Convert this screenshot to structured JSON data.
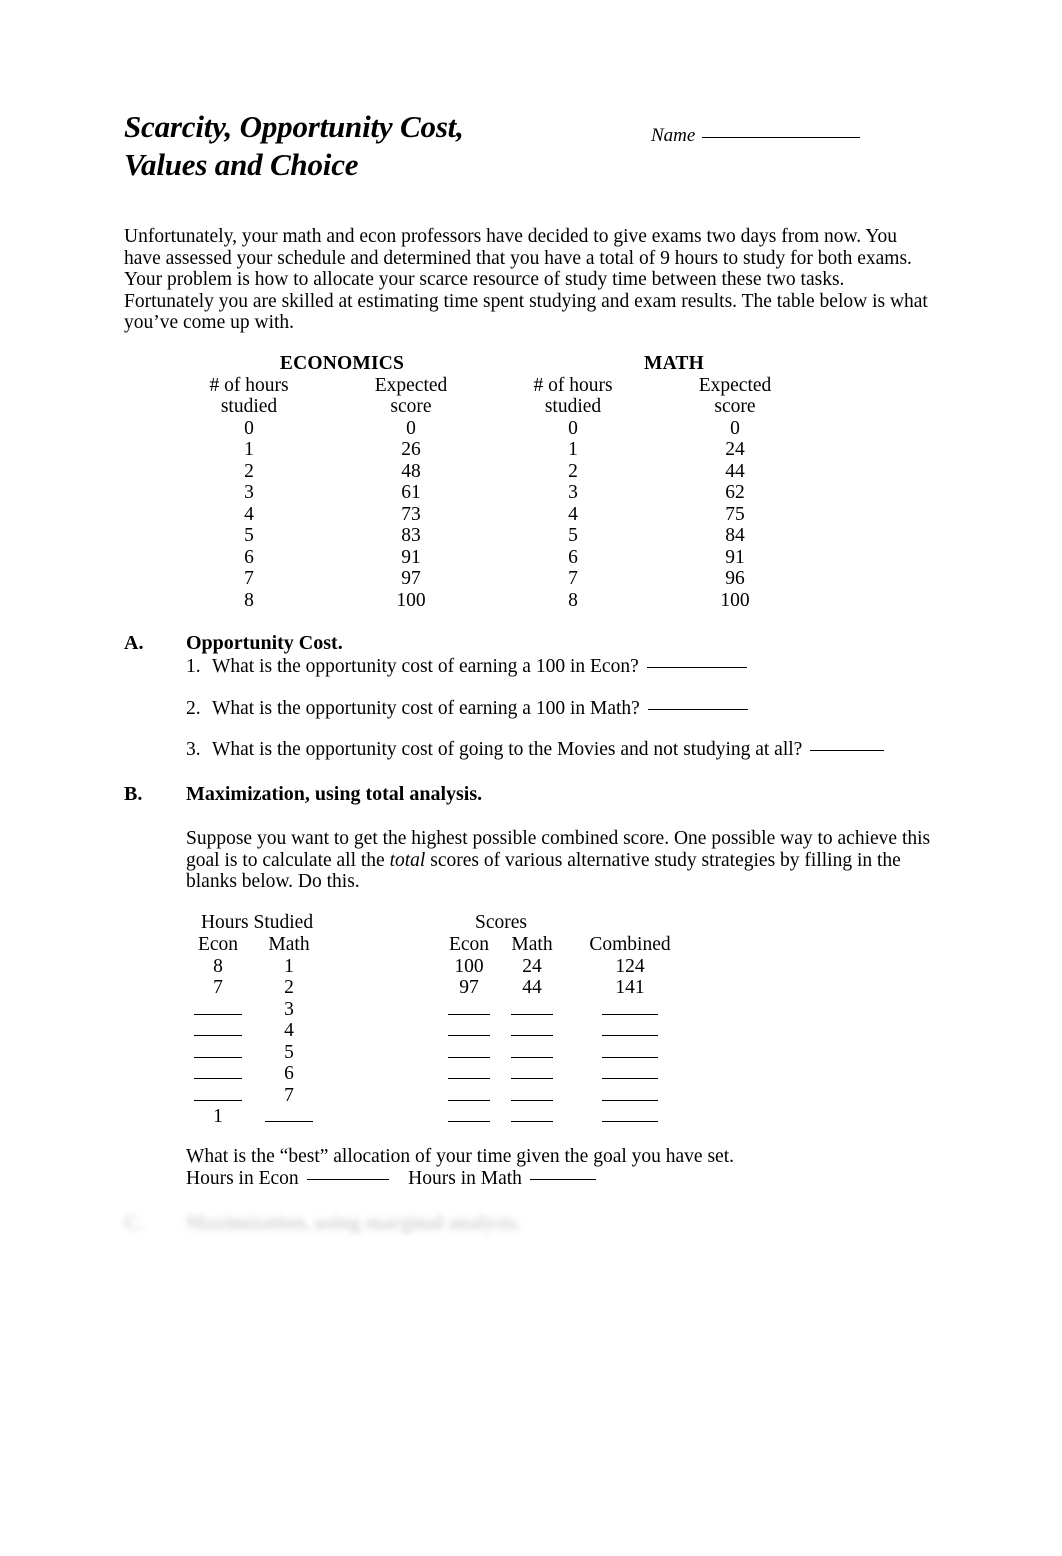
{
  "document": {
    "title": "Scarcity, Opportunity Cost,\nValues and Choice",
    "name_label": "Name",
    "intro": "Unfortunately, your math and econ professors have decided to give exams two days from now.  You have assessed your schedule and determined that you have a total of 9 hours to study for both exams.  Your problem is how to allocate your scarce resource of study time between these two tasks.   Fortunately you are skilled at estimating time spent studying and exam results.  The table below is what you’ve come up with."
  },
  "study_table": {
    "subjects": [
      "ECONOMICS",
      "MATH"
    ],
    "headers": [
      "# of hours\nstudied",
      "Expected\nscore",
      "# of hours\nstudied",
      "Expected\nscore"
    ],
    "rows": [
      [
        "0",
        "0",
        "0",
        "0"
      ],
      [
        "1",
        "26",
        "1",
        "24"
      ],
      [
        "2",
        "48",
        "2",
        "44"
      ],
      [
        "3",
        "61",
        "3",
        "62"
      ],
      [
        "4",
        "73",
        "4",
        "75"
      ],
      [
        "5",
        "83",
        "5",
        "84"
      ],
      [
        "6",
        "91",
        "6",
        "91"
      ],
      [
        "7",
        "97",
        "7",
        "96"
      ],
      [
        "8",
        "100",
        "8",
        "100"
      ]
    ]
  },
  "section_a": {
    "letter": "A.",
    "title": "Opportunity Cost.",
    "questions": [
      {
        "num": "1.",
        "text": "What is the opportunity cost of earning a 100 in Econ?"
      },
      {
        "num": "2.",
        "text": "What is the opportunity cost of earning a 100 in Math?"
      },
      {
        "num": "3.",
        "text": "What is the opportunity cost of going to the Movies and not studying at all?"
      }
    ]
  },
  "section_b": {
    "letter": "B.",
    "title": "Maximization, using total analysis.",
    "paragraph_part1": "Suppose you want to get the highest possible combined score.  One possible way to achieve this goal is to calculate all the ",
    "paragraph_italic": "total",
    "paragraph_part2": " scores of various alternative study strategies by filling in the blanks below.  Do this.",
    "group_headers": {
      "hours": "Hours Studied",
      "scores": "Scores"
    },
    "column_headers": [
      "Econ",
      "Math",
      "Econ",
      "Math",
      "Combined"
    ],
    "rows": [
      {
        "hours_econ": "8",
        "hours_math": "1",
        "score_econ": "100",
        "score_math": "24",
        "combined": "124"
      },
      {
        "hours_econ": "7",
        "hours_math": "2",
        "score_econ": "97",
        "score_math": "44",
        "combined": "141"
      },
      {
        "hours_econ": "",
        "hours_math": "3",
        "score_econ": "",
        "score_math": "",
        "combined": ""
      },
      {
        "hours_econ": "",
        "hours_math": "4",
        "score_econ": "",
        "score_math": "",
        "combined": ""
      },
      {
        "hours_econ": "",
        "hours_math": "5",
        "score_econ": "",
        "score_math": "",
        "combined": ""
      },
      {
        "hours_econ": "",
        "hours_math": "6",
        "score_econ": "",
        "score_math": "",
        "combined": ""
      },
      {
        "hours_econ": "",
        "hours_math": "7",
        "score_econ": "",
        "score_math": "",
        "combined": ""
      },
      {
        "hours_econ": "1",
        "hours_math": "",
        "score_econ": "",
        "score_math": "",
        "combined": ""
      }
    ],
    "closing_line1": "What is the “best” allocation of your time given the goal you have set.",
    "closing_econ_label": "Hours in Econ",
    "closing_math_label": "Hours in Math"
  },
  "section_c": {
    "letter": "C.",
    "title": "Maximization, using marginal analysis."
  }
}
